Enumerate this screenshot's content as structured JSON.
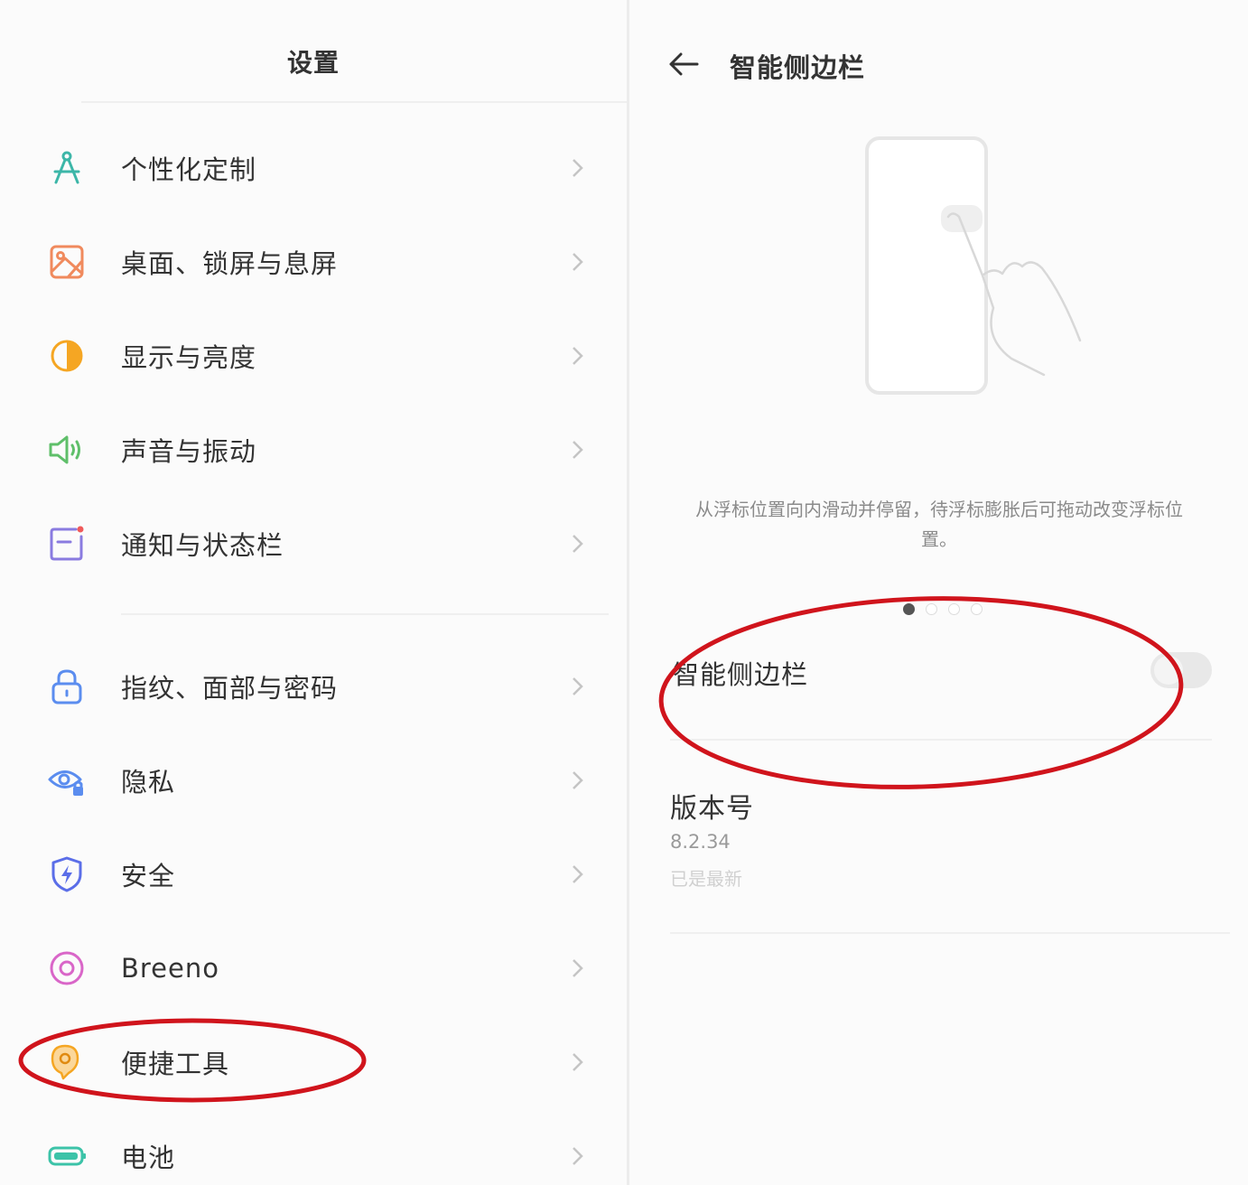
{
  "left_panel": {
    "title": "设置",
    "items": [
      {
        "label": "个性化定制",
        "icon": "personalization-icon",
        "color": "#3cb6a8"
      },
      {
        "label": "桌面、锁屏与息屏",
        "icon": "wallpaper-icon",
        "color": "#f08a5d"
      },
      {
        "label": "显示与亮度",
        "icon": "brightness-icon",
        "color": "#f5a623"
      },
      {
        "label": "声音与振动",
        "icon": "speaker-icon",
        "color": "#5fbf6a"
      },
      {
        "label": "通知与状态栏",
        "icon": "notification-icon",
        "color": "#8a7be0"
      },
      {
        "label": "指纹、面部与密码",
        "icon": "lock-icon",
        "color": "#5b8def"
      },
      {
        "label": "隐私",
        "icon": "privacy-eye-icon",
        "color": "#5b8def"
      },
      {
        "label": "安全",
        "icon": "security-shield-icon",
        "color": "#5b6ee8"
      },
      {
        "label": "Breeno",
        "icon": "breeno-icon",
        "color": "#d966c8"
      },
      {
        "label": "便捷工具",
        "icon": "convenience-tools-icon",
        "color": "#f5a623"
      },
      {
        "label": "电池",
        "icon": "battery-icon",
        "color": "#3cc3a8"
      }
    ]
  },
  "right_panel": {
    "title": "智能侧边栏",
    "description": "从浮标位置向内滑动并停留，待浮标膨胀后可拖动改变浮标位置。",
    "carousel_pages": 4,
    "carousel_active": 1,
    "toggle": {
      "label": "智能侧边栏",
      "on": false
    },
    "version": {
      "label": "版本号",
      "value": "8.2.34",
      "status": "已是最新"
    }
  },
  "colors": {
    "annotation": "#d0141c",
    "chevron": "#c4c4c4"
  }
}
